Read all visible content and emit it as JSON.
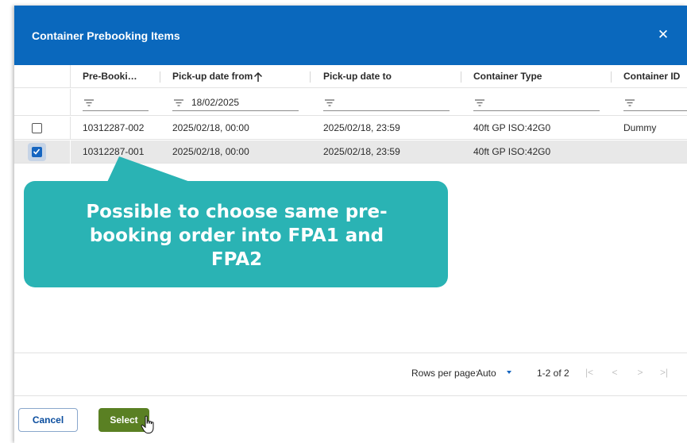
{
  "dialog": {
    "title": "Container Prebooking Items",
    "close_glyph": "✕"
  },
  "grid": {
    "columns": [
      {
        "label": "Pre-Booki…"
      },
      {
        "label": "Pick-up date from"
      },
      {
        "label": "Pick-up date to"
      },
      {
        "label": "Container Type"
      },
      {
        "label": "Container ID"
      }
    ],
    "sort": {
      "column": "Pick-up date from",
      "direction": "ascending",
      "icon": "arrow-up-icon"
    },
    "filters": {
      "prebooking": "",
      "pickup_from": "18/02/2025",
      "pickup_to": "",
      "container_type": "",
      "container_id": ""
    },
    "rows": [
      {
        "checked": false,
        "prebooking": "10312287-002",
        "pickup_from": "2025/02/18, 00:00",
        "pickup_to": "2025/02/18, 23:59",
        "container_type": "40ft GP ISO:42G0",
        "container_id": "Dummy"
      },
      {
        "checked": true,
        "prebooking": "10312287-001",
        "pickup_from": "2025/02/18, 00:00",
        "pickup_to": "2025/02/18, 23:59",
        "container_type": "40ft GP ISO:42G0",
        "container_id": ""
      }
    ]
  },
  "pager": {
    "rows_per_page_label": "Rows per page:",
    "rows_per_page_value": "Auto",
    "range": "1-2 of 2",
    "nav_icons": [
      "first-page-icon",
      "prev-page-icon",
      "next-page-icon",
      "last-page-icon"
    ]
  },
  "footer": {
    "cancel_label": "Cancel",
    "select_label": "Select"
  },
  "callout": {
    "line1": "Possible to choose same pre-",
    "line2": "booking order into FPA1 and",
    "line3": "FPA2"
  },
  "colors": {
    "header_blue": "#0a68bd",
    "select_green": "#5a8023",
    "checkbox_blue": "#1565c0",
    "callout_teal": "#2ab3b4"
  }
}
